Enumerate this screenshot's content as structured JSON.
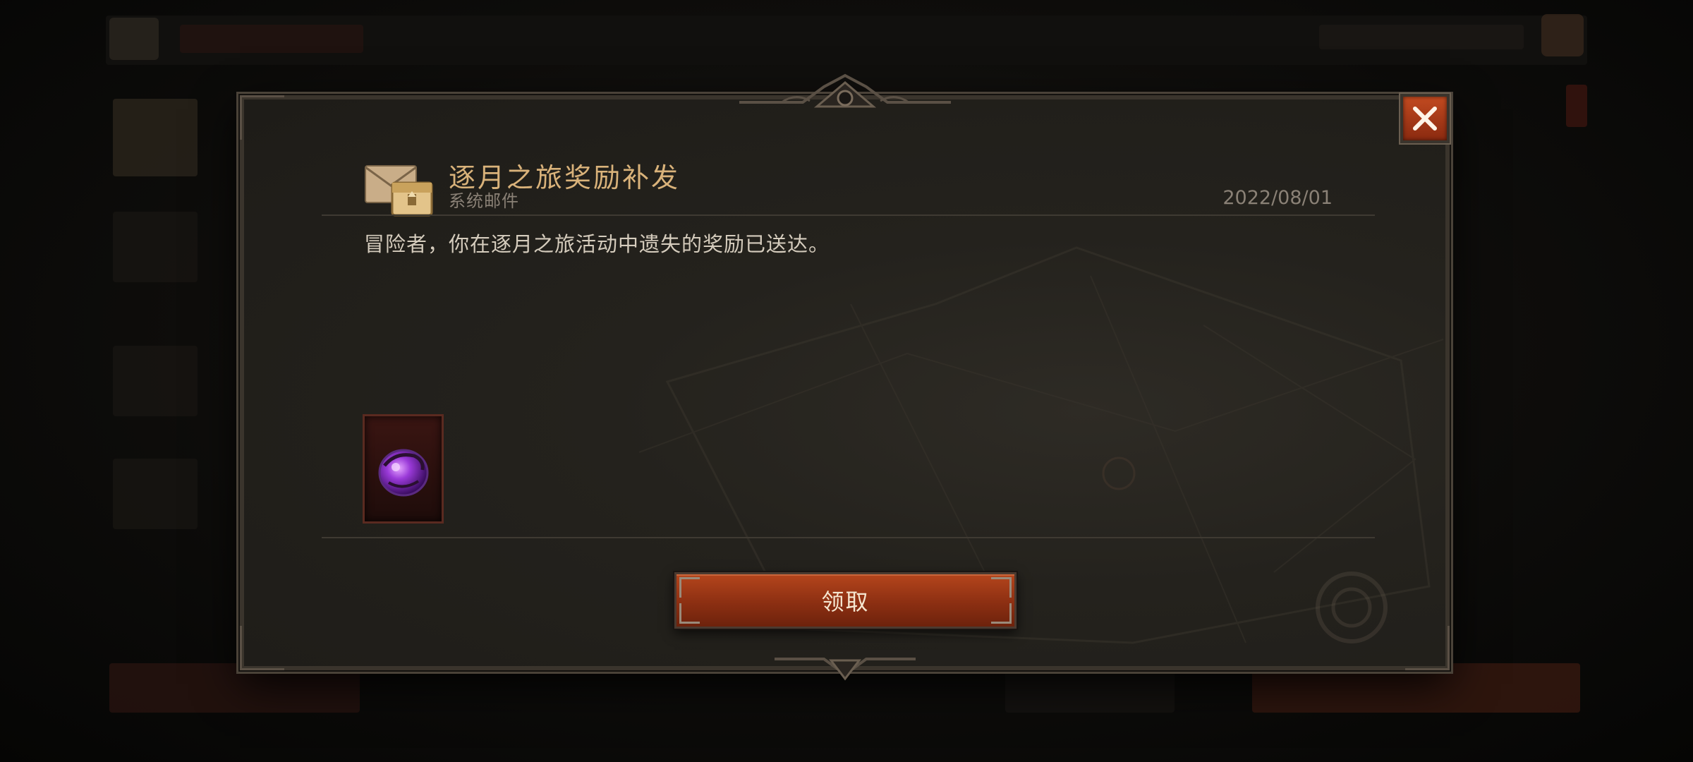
{
  "mail": {
    "title": "逐月之旅奖励补发",
    "subtitle": "系统邮件",
    "date": "2022/08/01",
    "body": "冒险者，你在逐月之旅活动中遗失的奖励已送达。"
  },
  "rewards": [
    {
      "icon": "purple-gem-icon"
    }
  ],
  "actions": {
    "claim_label": "领取",
    "close_icon": "close-icon"
  },
  "colors": {
    "title": "#d9b27a",
    "accent_button": "#a83c18",
    "panel": "#24221d"
  }
}
